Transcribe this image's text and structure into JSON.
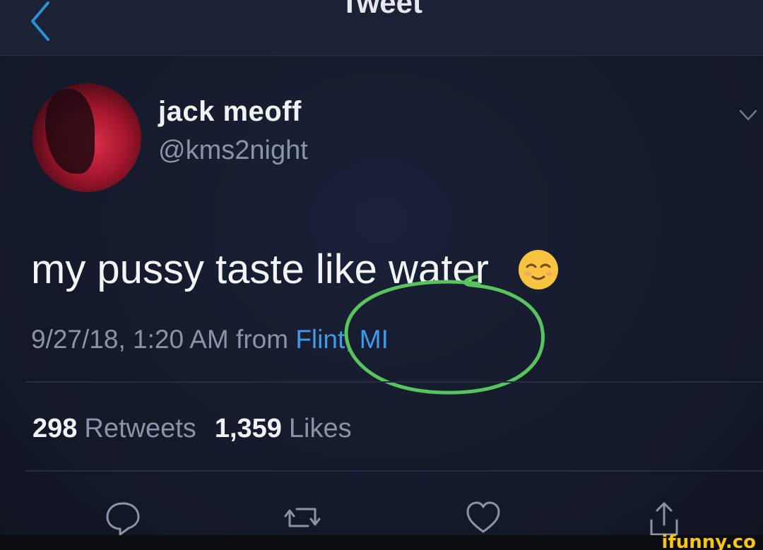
{
  "header": {
    "back_icon": "chevron-left-icon",
    "title": "Tweet"
  },
  "author": {
    "display_name": "jack meoff",
    "handle": "@kms2night",
    "menu_icon": "chevron-down-icon"
  },
  "tweet": {
    "text": "my pussy taste like water",
    "emoji": "relieved-face-emoji",
    "timestamp": "9/27/18, 1:20 AM from",
    "location": "Flint, MI"
  },
  "stats": {
    "retweets_count": "298",
    "retweets_label": "Retweets",
    "likes_count": "1,359",
    "likes_label": "Likes"
  },
  "actions": [
    {
      "name": "reply",
      "icon": "reply-icon"
    },
    {
      "name": "retweet",
      "icon": "retweet-icon"
    },
    {
      "name": "like",
      "icon": "heart-icon"
    },
    {
      "name": "share",
      "icon": "share-icon"
    }
  ],
  "watermark": "ifunny.co",
  "colors": {
    "background": "#151a2b",
    "accent": "#3d9be9",
    "annotation": "#58c45e",
    "watermark": "#f7c514"
  }
}
